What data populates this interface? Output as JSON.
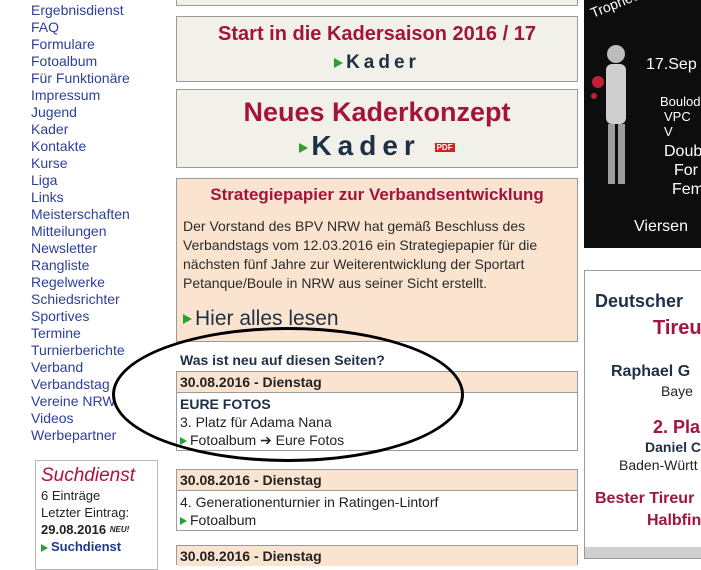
{
  "nav": {
    "items": [
      "Ergebnisdienst",
      "FAQ",
      "Formulare",
      "Fotoalbum",
      "Für Funktionäre",
      "Impressum",
      "Jugend",
      "Kader",
      "Kontakte",
      "Kurse",
      "Liga",
      "Links",
      "Meisterschaften",
      "Mitteilungen",
      "Newsletter",
      "Rangliste",
      "Regelwerke",
      "Schiedsrichter",
      "Sportives",
      "Termine",
      "Turnierberichte",
      "Verband",
      "Verbandstag",
      "Vereine NRW",
      "Videos",
      "Werbepartner"
    ]
  },
  "suchdienst": {
    "title": "Suchdienst",
    "count": "6 Einträge",
    "last_label": "Letzter Eintrag:",
    "last_date": "29.08.2016",
    "new_badge": "NEU!",
    "link": "Suchdienst"
  },
  "start_box": {
    "title": "Start in die Kadersaison 2016 / 17",
    "link": "Kader"
  },
  "neu_box": {
    "title": "Neues Kaderkonzept",
    "link": "Kader",
    "pdf": "PDF"
  },
  "strategie": {
    "title": "Strategiepapier zur Verbandsentwicklung",
    "text": "Der Vorstand des BPV NRW hat gemäß Beschluss des Verbandstags vom 12.03.2016 ein Strategiepapier für die nächsten fünf Jahre zur Weiterentwicklung der Sportart Petanque/Boule in NRW aus seiner Sicht erstellt.",
    "read_more": "Hier alles lesen"
  },
  "whatsnew": {
    "title": "Was ist neu auf diesen Seiten?"
  },
  "entries": [
    {
      "date": "30.08.2016 - Dienstag",
      "title": "EURE FOTOS",
      "text": "3. Platz für Adama Nana",
      "link": "Fotoalbum ➔ Eure Fotos"
    },
    {
      "date": "30.08.2016 - Dienstag",
      "text": "4. Generationenturnier in Ratingen-Lintorf",
      "link": "Fotoalbum"
    },
    {
      "date": "30.08.2016 - Dienstag"
    }
  ],
  "poster": {
    "line1": "Trophee des D",
    "date": "17.Sep",
    "l3": "Boulod",
    "l4": "VPC V",
    "l5": "Doub",
    "l6": "For",
    "l7": "Fem",
    "city": "Viersen"
  },
  "right_box": {
    "h1": "Deutscher",
    "h2": "Tireur",
    "name1": "Raphael G",
    "region1": "Baye",
    "place2": "2. Pla",
    "name2": "Daniel C",
    "region2": "Baden-Württ",
    "h3": "Bester Tireur",
    "h4": "Halbfin"
  }
}
